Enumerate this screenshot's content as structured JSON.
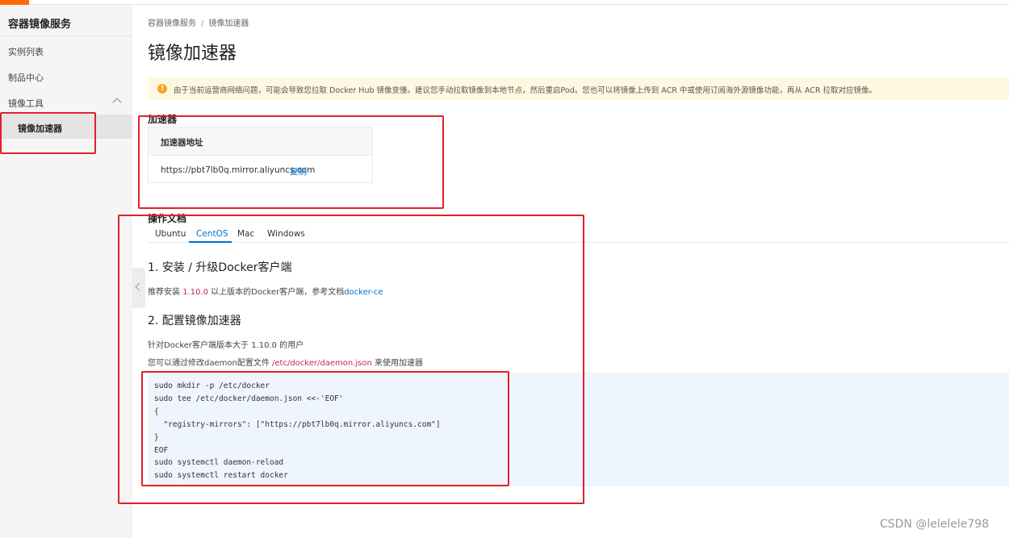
{
  "sidebar": {
    "title": "容器镜像服务",
    "items": [
      {
        "label": "实例列表"
      },
      {
        "label": "制品中心"
      },
      {
        "label": "镜像工具"
      },
      {
        "label": "镜像加速器"
      }
    ]
  },
  "breadcrumb": [
    "容器镜像服务",
    "镜像加速器"
  ],
  "page": {
    "title": "镜像加速器",
    "notice": "由于当前运营商网络问题，可能会导致您拉取 Docker Hub 镜像变慢。建议您手动拉取镜像到本地节点，然后重启Pod。您也可以将镜像上传到 ACR 中或使用订阅海外源镜像功能，再从 ACR 拉取对应镜像。"
  },
  "accelerator": {
    "section_title": "加速器",
    "column_header": "加速器地址",
    "url": "https://pbt7lb0q.mirror.aliyuncs.com",
    "copy_label": "复制"
  },
  "docs": {
    "section_title": "操作文档",
    "tabs": [
      "Ubuntu",
      "CentOS",
      "Mac",
      "Windows"
    ],
    "active_tab": "CentOS",
    "step1_title": "1. 安装 / 升级Docker客户端",
    "step1_text_a": "推荐安装 ",
    "step1_version": "1.10.0",
    "step1_text_b": " 以上版本的Docker客户端，参考文档",
    "step1_link": "docker-ce",
    "step2_title": "2. 配置镜像加速器",
    "step2_text1": "针对Docker客户端版本大于 1.10.0 的用户",
    "step2_text2_a": "您可以通过修改daemon配置文件 ",
    "step2_path": "/etc/docker/daemon.json",
    "step2_text2_b": " 来使用加速器",
    "code": "sudo mkdir -p /etc/docker\nsudo tee /etc/docker/daemon.json <<-'EOF'\n{\n  \"registry-mirrors\": [\"https://pbt7lb0q.mirror.aliyuncs.com\"]\n}\nEOF\nsudo systemctl daemon-reload\nsudo systemctl restart docker"
  },
  "watermark": "CSDN @lelelele798",
  "colors": {
    "accent": "#0070cc",
    "brand": "#ff6a00",
    "annotation": "#e0202a",
    "notice_bg": "#fff8e1",
    "code_bg": "#eef5fc"
  }
}
